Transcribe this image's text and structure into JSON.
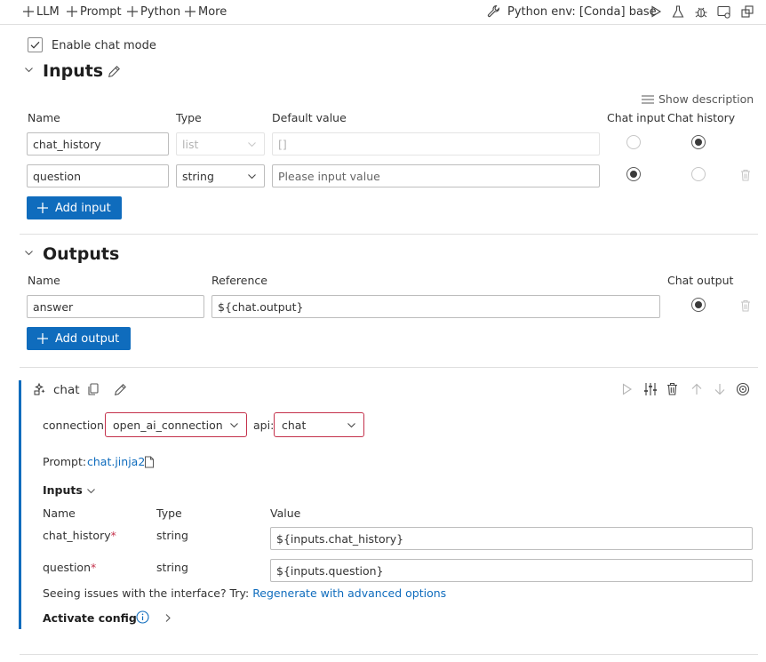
{
  "toolbar": {
    "llm_label": "LLM",
    "prompt_label": "Prompt",
    "python_label": "Python",
    "more_label": "More",
    "python_env_label": "Python env: [Conda] base"
  },
  "chat_mode": {
    "label": "Enable chat mode",
    "checked": true
  },
  "inputs_section": {
    "title": "Inputs",
    "show_description": "Show description",
    "columns": {
      "name": "Name",
      "type": "Type",
      "default": "Default value",
      "chat_input": "Chat input",
      "chat_history": "Chat history"
    },
    "rows": [
      {
        "name": "chat_history",
        "type": "list",
        "default": "[]"
      },
      {
        "name": "question",
        "type": "string",
        "default_placeholder": "Please input value"
      }
    ],
    "add_label": "Add input"
  },
  "outputs_section": {
    "title": "Outputs",
    "columns": {
      "name": "Name",
      "reference": "Reference",
      "chat_output": "Chat output"
    },
    "rows": [
      {
        "name": "answer",
        "reference": "${chat.output}"
      }
    ],
    "add_label": "Add output"
  },
  "node": {
    "name": "chat",
    "connection_label": "connection:",
    "connection_value": "open_ai_connection",
    "api_label": "api:",
    "api_value": "chat",
    "prompt_label": "Prompt:",
    "prompt_file": "chat.jinja2",
    "inputs_title": "Inputs",
    "columns": {
      "name": "Name",
      "type": "Type",
      "value": "Value"
    },
    "rows": [
      {
        "name": "chat_history",
        "required": "*",
        "type": "string",
        "value": "${inputs.chat_history}"
      },
      {
        "name": "question",
        "required": "*",
        "type": "string",
        "value": "${inputs.question}"
      }
    ],
    "issues_text": "Seeing issues with the interface? Try:",
    "issues_link": "Regenerate with advanced options",
    "activate_config": "Activate config"
  },
  "colors": {
    "accent": "#0f6cbd",
    "error": "#c4314b"
  }
}
